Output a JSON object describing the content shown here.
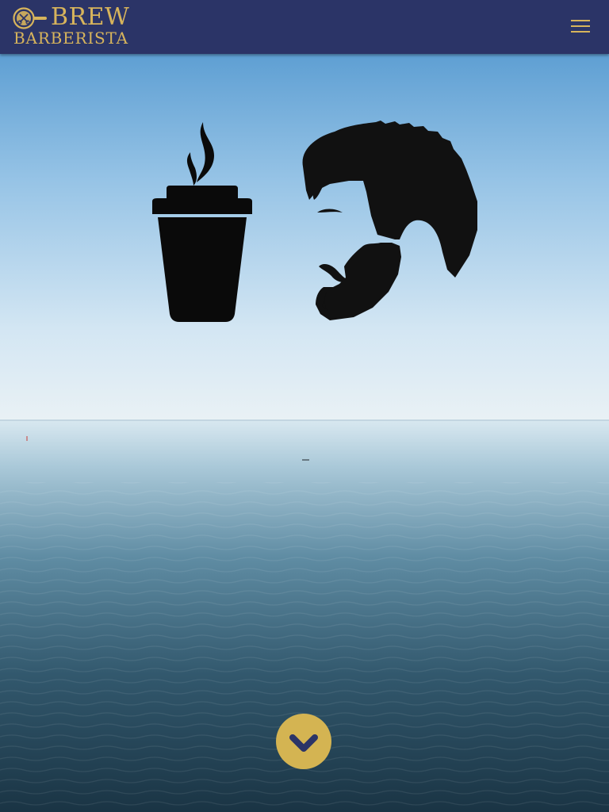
{
  "brand": {
    "line1": "BREW",
    "line2": "BARBERISTA",
    "color": "#d7b45c"
  },
  "header": {
    "background": "#2b3467",
    "menu_icon": "hamburger-menu-icon"
  },
  "hero": {
    "icons": [
      "coffee-cup-icon",
      "bearded-man-icon"
    ],
    "scroll_button_icon": "chevron-down-icon",
    "scroll_button_color": "#d4b452"
  }
}
